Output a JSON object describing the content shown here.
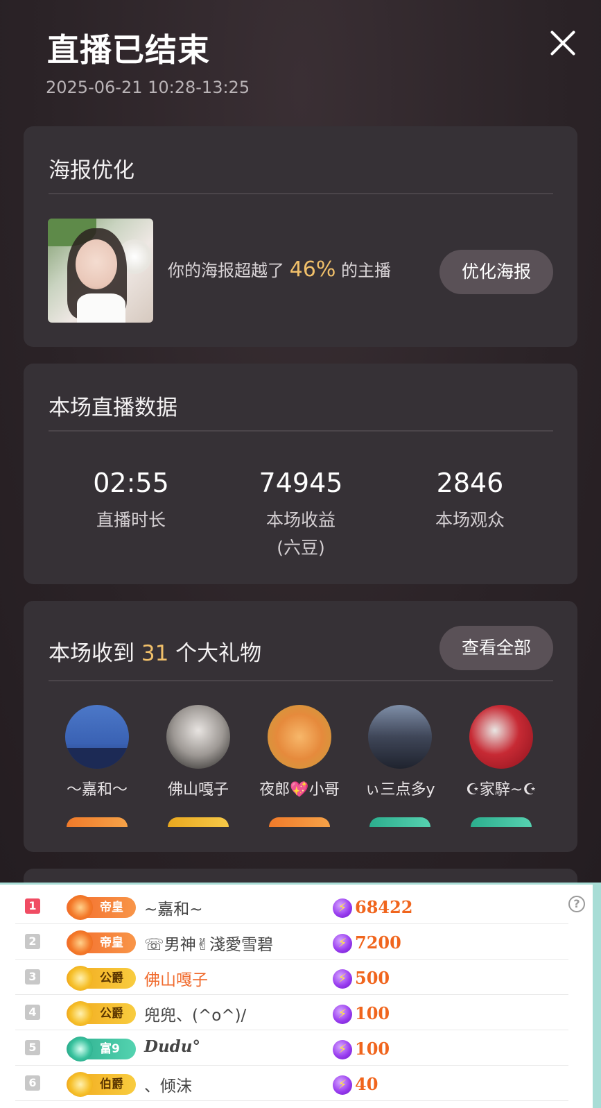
{
  "header": {
    "title": "直播已结束",
    "datetime": "2025-06-21 10:28-13:25"
  },
  "poster": {
    "title": "海报优化",
    "text_prefix": "你的海报超越了 ",
    "percent": "46%",
    "text_suffix": " 的主播",
    "button": "优化海报"
  },
  "stats": {
    "title": "本场直播数据",
    "items": [
      {
        "value": "02:55",
        "label": "直播时长"
      },
      {
        "value": "74945",
        "label": "本场收益",
        "sub": "(六豆)"
      },
      {
        "value": "2846",
        "label": "本场观众"
      }
    ]
  },
  "gifts": {
    "title_prefix": "本场收到 ",
    "count": "31",
    "title_suffix": " 个大礼物",
    "button": "查看全部",
    "gifters": [
      {
        "name": "～嘉和～"
      },
      {
        "name": "佛山嘎子"
      },
      {
        "name": "夜郎💖小哥"
      },
      {
        "name": "ぃ三点多y"
      },
      {
        "name": "☪家騂~☪"
      }
    ]
  },
  "ranking": {
    "help": "?",
    "rows": [
      {
        "rank": "1",
        "level": "帝皇",
        "name": "~嘉和~",
        "amount": "68422"
      },
      {
        "rank": "2",
        "level": "帝皇",
        "name": "☏男神✌淺愛雪碧",
        "amount": "7200"
      },
      {
        "rank": "3",
        "level": "公爵",
        "name": "佛山嘎子",
        "amount": "500"
      },
      {
        "rank": "4",
        "level": "公爵",
        "name": "兜兜、(^o^)/",
        "amount": "100"
      },
      {
        "rank": "5",
        "level": "富9",
        "name": "Dudu°",
        "amount": "100"
      },
      {
        "rank": "6",
        "level": "伯爵",
        "name": "、倾沫",
        "amount": "40"
      }
    ]
  }
}
